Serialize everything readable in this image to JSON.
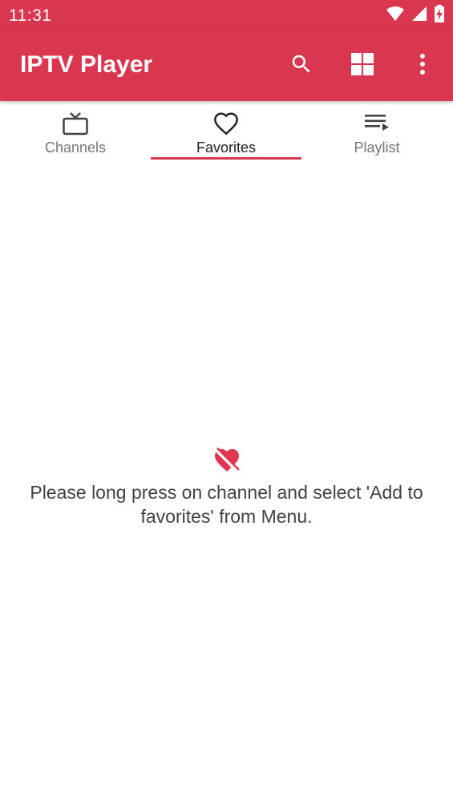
{
  "status_bar": {
    "time": "11:31",
    "icons": [
      "wifi-icon",
      "signal-icon",
      "battery-charging-icon"
    ]
  },
  "app_bar": {
    "title": "IPTV Player",
    "actions": [
      "search-icon",
      "grid-view-icon",
      "more-vert-icon"
    ]
  },
  "tabs": [
    {
      "label": "Channels",
      "icon": "tv-icon",
      "selected": false
    },
    {
      "label": "Favorites",
      "icon": "heart-outline-icon",
      "selected": true
    },
    {
      "label": "Playlist",
      "icon": "playlist-icon",
      "selected": false
    }
  ],
  "empty_state": {
    "icon": "heart-broken-icon",
    "message": "Please long press on channel and select 'Add to favorites' from Menu."
  },
  "colors": {
    "primary": "#d9374f",
    "on_primary": "#ffffff",
    "tab_active_text": "#212121",
    "tab_inactive_text": "#757575",
    "message_text": "#424242"
  }
}
